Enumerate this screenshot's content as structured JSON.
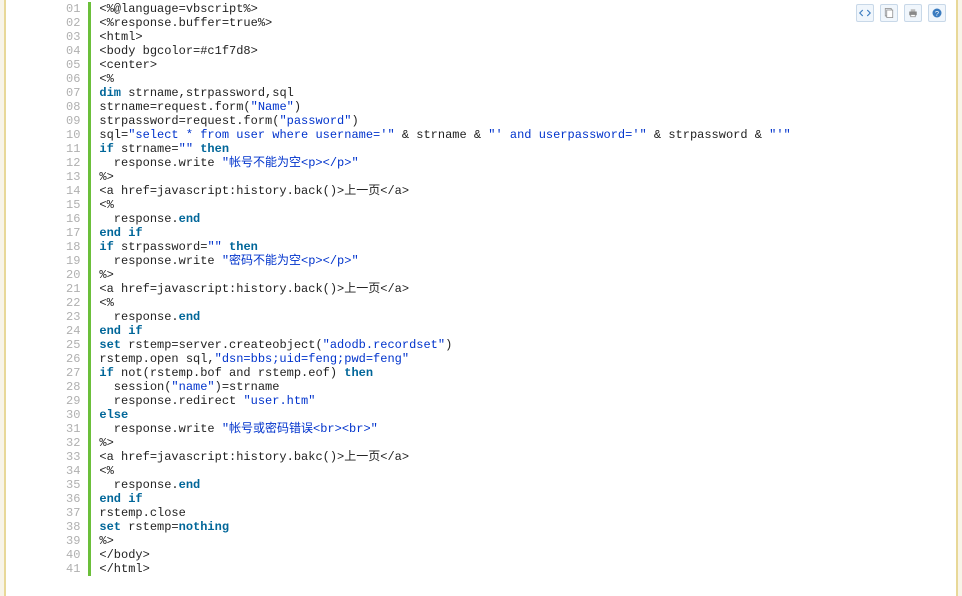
{
  "toolbar": {
    "view_source": "view-source",
    "copy": "copy",
    "print": "print",
    "help": "help"
  },
  "code": {
    "lines": [
      [
        {
          "t": "plain",
          "s": "<%@language=vbscript%>"
        }
      ],
      [
        {
          "t": "plain",
          "s": "<%response.buffer=true%>"
        }
      ],
      [
        {
          "t": "plain",
          "s": "<html>"
        }
      ],
      [
        {
          "t": "plain",
          "s": "<body bgcolor=#c1f7d8>"
        }
      ],
      [
        {
          "t": "plain",
          "s": "<center>"
        }
      ],
      [
        {
          "t": "plain",
          "s": "<%"
        }
      ],
      [
        {
          "t": "kw",
          "s": "dim"
        },
        {
          "t": "plain",
          "s": " strname,strpassword,sql"
        }
      ],
      [
        {
          "t": "plain",
          "s": "strname=request.form("
        },
        {
          "t": "str",
          "s": "\"Name\""
        },
        {
          "t": "plain",
          "s": ")"
        }
      ],
      [
        {
          "t": "plain",
          "s": "strpassword=request.form("
        },
        {
          "t": "str",
          "s": "\"password\""
        },
        {
          "t": "plain",
          "s": ")"
        }
      ],
      [
        {
          "t": "plain",
          "s": "sql="
        },
        {
          "t": "str",
          "s": "\"select * from user where username='\""
        },
        {
          "t": "plain",
          "s": " & strname & "
        },
        {
          "t": "str",
          "s": "\"' and userpassword='\""
        },
        {
          "t": "plain",
          "s": " & strpassword & "
        },
        {
          "t": "str",
          "s": "\"'\""
        }
      ],
      [
        {
          "t": "kw",
          "s": "if"
        },
        {
          "t": "plain",
          "s": " strname="
        },
        {
          "t": "str",
          "s": "\"\""
        },
        {
          "t": "plain",
          "s": " "
        },
        {
          "t": "kw",
          "s": "then"
        }
      ],
      [
        {
          "t": "plain",
          "s": "  response.write "
        },
        {
          "t": "str",
          "s": "\"帐号不能为空<p></p>\""
        }
      ],
      [
        {
          "t": "plain",
          "s": "%>"
        }
      ],
      [
        {
          "t": "plain",
          "s": "<a href=javascript:history.back()>上一页</a>"
        }
      ],
      [
        {
          "t": "plain",
          "s": "<%"
        }
      ],
      [
        {
          "t": "plain",
          "s": "  response."
        },
        {
          "t": "kw",
          "s": "end"
        }
      ],
      [
        {
          "t": "kw",
          "s": "end"
        },
        {
          "t": "plain",
          "s": " "
        },
        {
          "t": "kw",
          "s": "if"
        }
      ],
      [
        {
          "t": "kw",
          "s": "if"
        },
        {
          "t": "plain",
          "s": " strpassword="
        },
        {
          "t": "str",
          "s": "\"\""
        },
        {
          "t": "plain",
          "s": " "
        },
        {
          "t": "kw",
          "s": "then"
        }
      ],
      [
        {
          "t": "plain",
          "s": "  response.write "
        },
        {
          "t": "str",
          "s": "\"密码不能为空<p></p>\""
        }
      ],
      [
        {
          "t": "plain",
          "s": "%>"
        }
      ],
      [
        {
          "t": "plain",
          "s": "<a href=javascript:history.back()>上一页</a>"
        }
      ],
      [
        {
          "t": "plain",
          "s": "<%"
        }
      ],
      [
        {
          "t": "plain",
          "s": "  response."
        },
        {
          "t": "kw",
          "s": "end"
        }
      ],
      [
        {
          "t": "kw",
          "s": "end"
        },
        {
          "t": "plain",
          "s": " "
        },
        {
          "t": "kw",
          "s": "if"
        }
      ],
      [
        {
          "t": "kw",
          "s": "set"
        },
        {
          "t": "plain",
          "s": " rstemp=server.createobject("
        },
        {
          "t": "str",
          "s": "\"adodb.recordset\""
        },
        {
          "t": "plain",
          "s": ")"
        }
      ],
      [
        {
          "t": "plain",
          "s": "rstemp.open sql,"
        },
        {
          "t": "str",
          "s": "\"dsn=bbs;uid=feng;pwd=feng\""
        }
      ],
      [
        {
          "t": "kw",
          "s": "if"
        },
        {
          "t": "plain",
          "s": " not(rstemp.bof and rstemp.eof) "
        },
        {
          "t": "kw",
          "s": "then"
        }
      ],
      [
        {
          "t": "plain",
          "s": "  session("
        },
        {
          "t": "str",
          "s": "\"name\""
        },
        {
          "t": "plain",
          "s": ")=strname"
        }
      ],
      [
        {
          "t": "plain",
          "s": "  response.redirect "
        },
        {
          "t": "str",
          "s": "\"user.htm\""
        }
      ],
      [
        {
          "t": "kw",
          "s": "else"
        }
      ],
      [
        {
          "t": "plain",
          "s": "  response.write "
        },
        {
          "t": "str",
          "s": "\"帐号或密码错误<br><br>\""
        }
      ],
      [
        {
          "t": "plain",
          "s": "%>"
        }
      ],
      [
        {
          "t": "plain",
          "s": "<a href=javascript:history.bakc()>上一页</a>"
        }
      ],
      [
        {
          "t": "plain",
          "s": "<%"
        }
      ],
      [
        {
          "t": "plain",
          "s": "  response."
        },
        {
          "t": "kw",
          "s": "end"
        }
      ],
      [
        {
          "t": "kw",
          "s": "end"
        },
        {
          "t": "plain",
          "s": " "
        },
        {
          "t": "kw",
          "s": "if"
        }
      ],
      [
        {
          "t": "plain",
          "s": "rstemp.close"
        }
      ],
      [
        {
          "t": "kw",
          "s": "set"
        },
        {
          "t": "plain",
          "s": " rstemp="
        },
        {
          "t": "kw",
          "s": "nothing"
        }
      ],
      [
        {
          "t": "plain",
          "s": "%>"
        }
      ],
      [
        {
          "t": "plain",
          "s": "</body>"
        }
      ],
      [
        {
          "t": "plain",
          "s": "</html>"
        }
      ]
    ]
  }
}
